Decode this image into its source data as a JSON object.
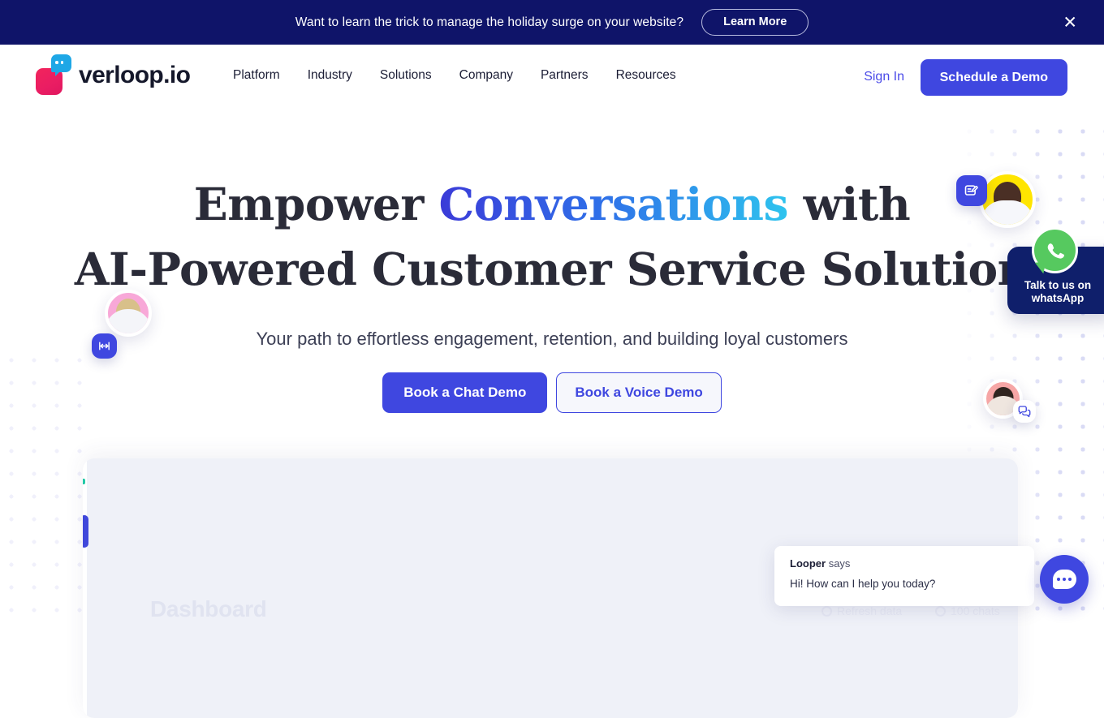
{
  "banner": {
    "text": "Want to learn the trick to manage the holiday surge on your website?",
    "cta_label": "Learn More",
    "close_icon": "close-icon",
    "close_glyph": "✕",
    "bg_color": "#0f1469"
  },
  "header": {
    "logo_text": "verloop.io",
    "nav": [
      {
        "label": "Platform"
      },
      {
        "label": "Industry"
      },
      {
        "label": "Solutions"
      },
      {
        "label": "Company"
      },
      {
        "label": "Partners"
      },
      {
        "label": "Resources"
      }
    ],
    "sign_in_label": "Sign In",
    "demo_button_label": "Schedule a Demo",
    "accent_color": "#3f47e0"
  },
  "hero": {
    "heading_part1": "Empower ",
    "heading_highlight": "Conversations",
    "heading_part2": " with",
    "heading_line2": "AI-Powered Customer Service Solution",
    "subheading": "Your path to effortless engagement, retention, and building loyal customers",
    "cta_primary_label": "Book a Chat Demo",
    "cta_secondary_label": "Book a Voice Demo",
    "highlight_gradient_from": "#3b3bd8",
    "highlight_gradient_to": "#2ec4ee"
  },
  "floating": {
    "avatar_left": {
      "name": "avatar-agent-left",
      "ring_color": "#f8a8d8",
      "badge_icon": "resize-width-icon"
    },
    "avatar_right_top": {
      "name": "avatar-agent-right-top",
      "ring_color": "#ffe500",
      "badge_icon": "form-edit-icon"
    },
    "avatar_right_bottom": {
      "name": "avatar-agent-right-bottom",
      "ring_color": "#f6a6a6",
      "badge_icon": "chat-bubbles-icon"
    }
  },
  "whatsapp": {
    "label_line1": "Talk to us on",
    "label_line2": "whatsApp",
    "icon": "whatsapp-icon",
    "bg_color": "#0f1f6b",
    "icon_color": "#56c95f"
  },
  "dashboard_preview": {
    "title": "Dashboard",
    "meta": [
      {
        "label": "Refresh data",
        "icon": "refresh-icon"
      },
      {
        "label": "100 chats",
        "icon": "chats-icon"
      }
    ]
  },
  "chat_widget": {
    "bot_name": "Looper",
    "says_label": "says",
    "message": "Hi! How can I help you today?",
    "launcher_icon": "chat-bubble-icon",
    "launcher_color": "#3f47e0"
  }
}
